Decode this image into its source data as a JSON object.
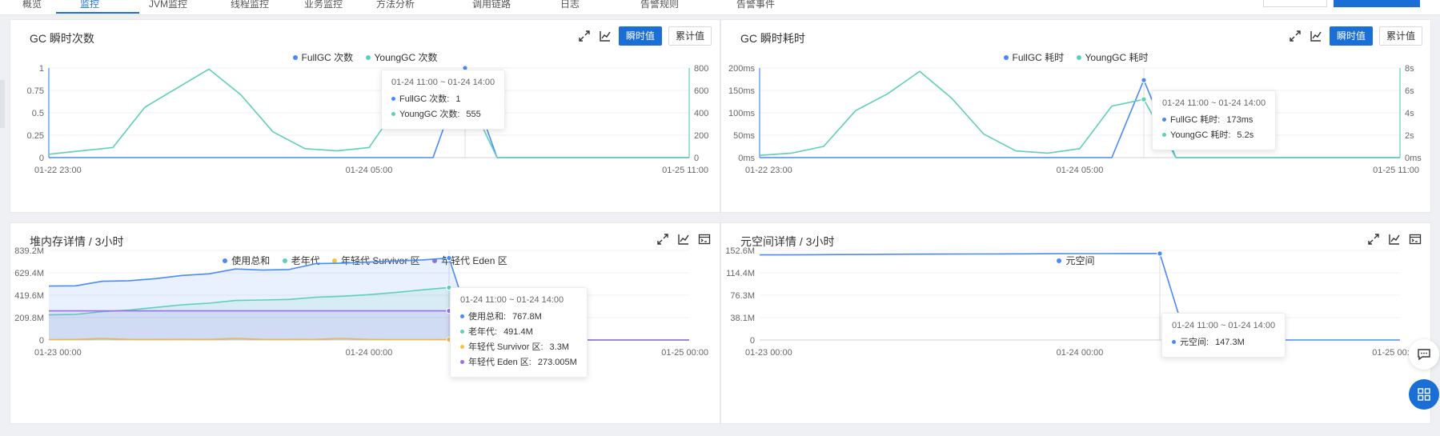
{
  "nav": {
    "tabs": [
      {
        "label": "概览"
      },
      {
        "label": "监控"
      },
      {
        "label": "JVM监控"
      },
      {
        "label": "线程监控"
      },
      {
        "label": "业务监控"
      },
      {
        "label": "方法分析"
      },
      {
        "label": "调用链路"
      },
      {
        "label": "日志"
      },
      {
        "label": "告警规则"
      },
      {
        "label": "告警事件"
      }
    ]
  },
  "panels": [
    {
      "id": "gc-count",
      "title": "GC 瞬时次数",
      "toggle": {
        "instant": "瞬时值",
        "cumulative": "累计值",
        "active": "instant"
      },
      "legend": [
        {
          "name": "FullGC 次数",
          "color": "#4a8af4"
        },
        {
          "name": "YoungGC 次数",
          "color": "#5fcfb7"
        }
      ],
      "tooltip": {
        "title": "01-24 11:00 ~ 01-24 14:00",
        "rows": [
          {
            "label": "FullGC 次数:",
            "value": "1",
            "color": "#4a8af4"
          },
          {
            "label": "YoungGC 次数:",
            "value": "555",
            "color": "#5fcfb7"
          }
        ]
      }
    },
    {
      "id": "gc-time",
      "title": "GC 瞬时耗时",
      "toggle": {
        "instant": "瞬时值",
        "cumulative": "累计值",
        "active": "instant"
      },
      "legend": [
        {
          "name": "FullGC 耗时",
          "color": "#4a8af4"
        },
        {
          "name": "YoungGC 耗时",
          "color": "#5fcfb7"
        }
      ],
      "tooltip": {
        "title": "01-24 11:00 ~ 01-24 14:00",
        "rows": [
          {
            "label": "FullGC 耗时:",
            "value": "173ms",
            "color": "#4a8af4"
          },
          {
            "label": "YoungGC 耗时:",
            "value": "5.2s",
            "color": "#5fcfb7"
          }
        ]
      }
    },
    {
      "id": "heap",
      "title": "堆内存详情 / 3小时",
      "legend": [
        {
          "name": "使用总和",
          "color": "#4a8af4"
        },
        {
          "name": "老年代",
          "color": "#5fcfb7"
        },
        {
          "name": "年轻代 Survivor 区",
          "color": "#f6c243"
        },
        {
          "name": "年轻代 Eden 区",
          "color": "#9b6ee8"
        }
      ],
      "tooltip": {
        "title": "01-24 11:00 ~ 01-24 14:00",
        "rows": [
          {
            "label": "使用总和:",
            "value": "767.8M",
            "color": "#4a8af4"
          },
          {
            "label": "老年代:",
            "value": "491.4M",
            "color": "#5fcfb7"
          },
          {
            "label": "年轻代 Survivor 区:",
            "value": "3.3M",
            "color": "#f6c243"
          },
          {
            "label": "年轻代 Eden 区:",
            "value": "273.005M",
            "color": "#9b6ee8"
          }
        ]
      }
    },
    {
      "id": "metaspace",
      "title": "元空间详情 / 3小时",
      "legend": [
        {
          "name": "元空间",
          "color": "#4a8af4"
        }
      ],
      "tooltip": {
        "title": "01-24 11:00 ~ 01-24 14:00",
        "rows": [
          {
            "label": "元空间:",
            "value": "147.3M",
            "color": "#4a8af4"
          }
        ]
      }
    }
  ],
  "chart_data": [
    {
      "id": "gc-count",
      "type": "line",
      "title": "GC 瞬时次数",
      "x_labels": [
        "01-22 23:00",
        "01-24 05:00",
        "01-25 11:00"
      ],
      "left_axis": {
        "ticks": [
          "0",
          "0.25",
          "0.5",
          "0.75",
          "1"
        ],
        "ylim": [
          0,
          1
        ]
      },
      "right_axis": {
        "ticks": [
          "0",
          "200",
          "400",
          "600",
          "800"
        ],
        "ylim": [
          0,
          800
        ]
      },
      "points": 21,
      "hover_index": 13,
      "series": [
        {
          "name": "FullGC 次数",
          "color": "#4a8af4",
          "axis": "left",
          "values": [
            0,
            0,
            0,
            0,
            0,
            0,
            0,
            0,
            0,
            0,
            0,
            0,
            0,
            1,
            0,
            0,
            0,
            0,
            0,
            0,
            0
          ]
        },
        {
          "name": "YoungGC 次数",
          "color": "#5fcfb7",
          "axis": "right",
          "values": [
            30,
            60,
            90,
            450,
            620,
            790,
            560,
            230,
            80,
            60,
            90,
            500,
            555,
            600,
            0,
            0,
            0,
            0,
            0,
            0,
            0
          ]
        }
      ]
    },
    {
      "id": "gc-time",
      "type": "line",
      "title": "GC 瞬时耗时",
      "x_labels": [
        "01-22 23:00",
        "01-24 05:00",
        "01-25 11:00"
      ],
      "left_axis": {
        "ticks": [
          "0ms",
          "50ms",
          "100ms",
          "150ms",
          "200ms"
        ],
        "ylim": [
          0,
          200
        ]
      },
      "right_axis": {
        "ticks": [
          "0ms",
          "2s",
          "4s",
          "6s",
          "8s"
        ],
        "ylim": [
          0,
          8
        ]
      },
      "points": 21,
      "hover_index": 12,
      "series": [
        {
          "name": "FullGC 耗时",
          "color": "#4a8af4",
          "axis": "left",
          "values": [
            0,
            0,
            0,
            0,
            0,
            0,
            0,
            0,
            0,
            0,
            0,
            0,
            173,
            0,
            0,
            0,
            0,
            0,
            0,
            0,
            0
          ]
        },
        {
          "name": "YoungGC 耗时",
          "color": "#5fcfb7",
          "axis": "right",
          "values": [
            0.2,
            0.4,
            1.0,
            4.2,
            5.7,
            7.7,
            5.3,
            2.1,
            0.6,
            0.4,
            0.8,
            4.6,
            5.2,
            0,
            0,
            0,
            0,
            0,
            0,
            0,
            0
          ]
        }
      ]
    },
    {
      "id": "heap",
      "type": "area",
      "title": "堆内存详情 / 3小时",
      "x_labels": [
        "01-23 00:00",
        "01-24 00:00",
        "01-25 00:00"
      ],
      "left_axis": {
        "ticks": [
          "0",
          "209.8M",
          "419.6M",
          "629.4M",
          "839.2M"
        ],
        "ylim": [
          0,
          839.2
        ]
      },
      "points": 25,
      "hover_index": 15,
      "series": [
        {
          "name": "使用总和",
          "color": "#4a8af4",
          "values": [
            505,
            507,
            550,
            555,
            575,
            605,
            620,
            665,
            655,
            660,
            715,
            720,
            730,
            740,
            750,
            767.8,
            0,
            0,
            0,
            0,
            0,
            0,
            0,
            0,
            0
          ]
        },
        {
          "name": "老年代",
          "color": "#5fcfb7",
          "values": [
            235,
            240,
            265,
            280,
            305,
            330,
            345,
            370,
            375,
            380,
            400,
            410,
            425,
            445,
            470,
            491.4,
            0,
            0,
            0,
            0,
            0,
            0,
            0,
            0,
            0
          ]
        },
        {
          "name": "年轻代 Survivor 区",
          "color": "#f6c243",
          "values": [
            4,
            5,
            14,
            6,
            5,
            6,
            5,
            16,
            6,
            5,
            6,
            15,
            5,
            4,
            4,
            3.3,
            0,
            0,
            0,
            0,
            0,
            0,
            0,
            0,
            0
          ]
        },
        {
          "name": "年轻代 Eden 区",
          "color": "#9b6ee8",
          "values": [
            273,
            273,
            273,
            273,
            273,
            273,
            273,
            273,
            273,
            273,
            273,
            273,
            273,
            273,
            273,
            273.005,
            0,
            0,
            0,
            0,
            0,
            0,
            0,
            0,
            0
          ]
        }
      ]
    },
    {
      "id": "metaspace",
      "type": "line",
      "title": "元空间详情 / 3小时",
      "x_labels": [
        "01-23 00:00",
        "01-24 00:00",
        "01-25 00:00"
      ],
      "left_axis": {
        "ticks": [
          "0",
          "38.1M",
          "76.3M",
          "114.4M",
          "152.6M"
        ],
        "ylim": [
          0,
          152.6
        ]
      },
      "points": 25,
      "hover_index": 15,
      "series": [
        {
          "name": "元空间",
          "color": "#4a8af4",
          "values": [
            145,
            145,
            145.3,
            145.5,
            145.7,
            146,
            146.2,
            146.3,
            146.5,
            146.6,
            146.8,
            147,
            147.1,
            147.2,
            147.3,
            147.3,
            0,
            0,
            0,
            0,
            0,
            0,
            0,
            0,
            0
          ]
        }
      ]
    }
  ]
}
